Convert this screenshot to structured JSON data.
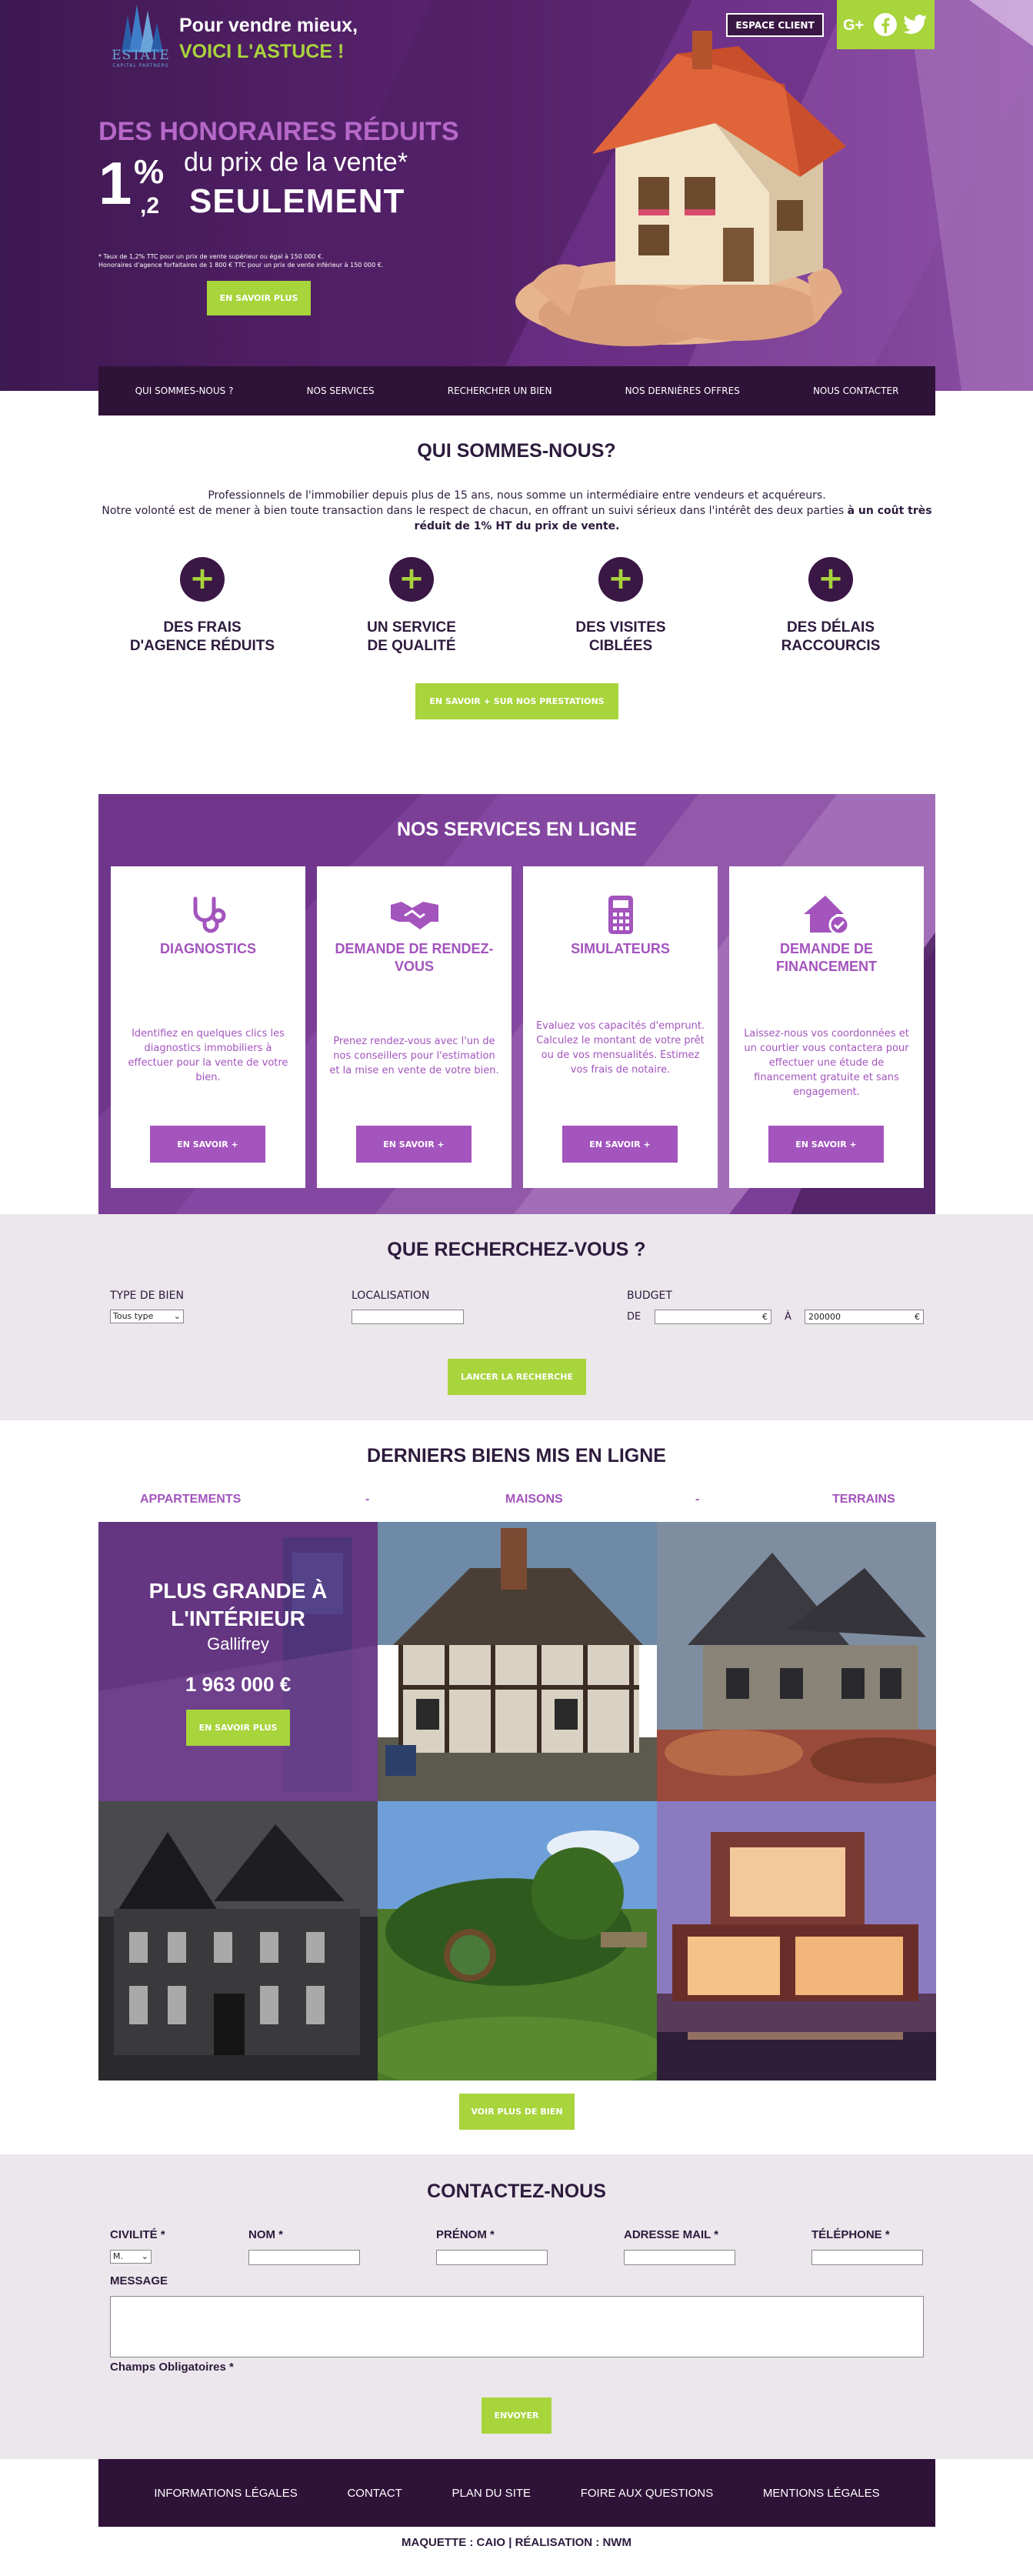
{
  "brand": {
    "name": "ESTATE",
    "tagline": "CAPITAL PARTNERS"
  },
  "slogan": {
    "line1": "Pour vendre mieux,",
    "line2": "VOICI L'ASTUCE !"
  },
  "header": {
    "client_button": "ESPACE CLIENT",
    "social_icons": [
      "google-plus-icon",
      "facebook-icon",
      "twitter-icon"
    ]
  },
  "hero": {
    "title": "DES HONORAIRES RÉDUITS",
    "percent_main": "1",
    "percent_sign": "%",
    "percent_decimal": ",2",
    "prix": "du prix de la vente*",
    "seulement": "SEULEMENT",
    "note_line1": "* Taux de 1,2% TTC pour un prix de vente supérieur ou égal à 150 000 €.",
    "note_line2": "Honoraires d'agence forfaitaires de 1 800 € TTC pour un prix de vente inférieur à 150 000 €.",
    "button": "EN SAVOIR PLUS"
  },
  "nav": {
    "items": [
      "QUI SOMMES-NOUS ?",
      "NOS SERVICES",
      "RECHERCHER UN BIEN",
      "NOS DERNIÈRES OFFRES",
      "NOUS CONTACTER"
    ]
  },
  "qui": {
    "title": "QUI SOMMES-NOUS?",
    "line1": "Professionnels de l'immobilier depuis plus de 15 ans, nous somme un intermédiaire entre vendeurs et acquéreurs.",
    "line2": "Notre volonté est de mener à bien toute transaction dans le respect de chacun, en offrant un suivi sérieux dans l'intérêt des deux parties ",
    "line2_bold": "à un coût très",
    "line3_bold": "réduit de 1% HT du prix de vente.",
    "features": [
      "DES FRAIS\nD'AGENCE RÉDUITS",
      "UN SERVICE\nDE QUALITÉ",
      "DES VISITES\nCIBLÉES",
      "DES DÉLAIS\nRACCOURCIS"
    ],
    "plus_symbol": "+",
    "button": "EN SAVOIR + SUR NOS PRESTATIONS"
  },
  "services": {
    "title": "NOS SERVICES EN LIGNE",
    "cards": [
      {
        "icon": "stethoscope-icon",
        "title": "DIAGNOSTICS",
        "desc": "Identifiez en quelques clics les diagnostics immobiliers à effectuer pour la vente de votre bien.",
        "button": "EN SAVOIR +"
      },
      {
        "icon": "handshake-icon",
        "title": "DEMANDE DE RENDEZ-VOUS",
        "desc": "Prenez rendez-vous avec l'un de nos conseillers pour l'estimation et la mise en vente de votre bien.",
        "button": "EN SAVOIR +"
      },
      {
        "icon": "calculator-icon",
        "title": "SIMULATEURS",
        "desc": "Evaluez vos capacités d'emprunt. Calculez le montant de votre prêt ou de vos mensualités. Estimez vos frais de notaire.",
        "button": "EN SAVOIR +"
      },
      {
        "icon": "house-check-icon",
        "title": "DEMANDE DE FINANCEMENT",
        "desc": "Laissez-nous vos coordonnées et un courtier vous contactera pour effectuer une étude de financement gratuite et sans engagement.",
        "button": "EN SAVOIR +"
      }
    ]
  },
  "search": {
    "title": "QUE RECHERCHEZ-VOUS ?",
    "type_label": "TYPE DE BIEN",
    "type_value": "Tous type",
    "loc_label": "LOCALISATION",
    "budget_label": "BUDGET",
    "de_label": "DE",
    "a_label": "À",
    "euro": "€",
    "max_value": "200000",
    "button": "LANCER LA RECHERCHE"
  },
  "listings": {
    "title": "DERNIERS BIENS MIS EN LIGNE",
    "tabs": [
      "APPARTEMENTS",
      "MAISONS",
      "TERRAINS"
    ],
    "separator": "-",
    "featured": {
      "title": "PLUS GRANDE À L'INTÉRIEUR",
      "location": "Gallifrey",
      "price": "1 963 000 €",
      "button": "EN SAVOIR PLUS"
    },
    "more_button": "VOIR PLUS DE BIEN"
  },
  "contact": {
    "title": "CONTACTEZ-NOUS",
    "fields": [
      "CIVILITÉ *",
      "NOM *",
      "PRÉNOM *",
      "ADRESSE MAIL *",
      "TÉLÉPHONE *"
    ],
    "civility_value": "M.",
    "message_label": "MESSAGE",
    "required_note": "Champs Obligatoires *",
    "button": "ENVOYER"
  },
  "footer": {
    "links": [
      "INFORMATIONS LÉGALES",
      "CONTACT",
      "PLAN DU SITE",
      "FOIRE AUX QUESTIONS",
      "MENTIONS LÉGALES"
    ],
    "credit": "MAQUETTE : CAIO | RÉALISATION : NWM"
  },
  "colors": {
    "purple_dark": "#2f1238",
    "purple_accent": "#a354bd",
    "green_accent": "#a8d43c",
    "grey_bg": "#ebe7ec"
  }
}
